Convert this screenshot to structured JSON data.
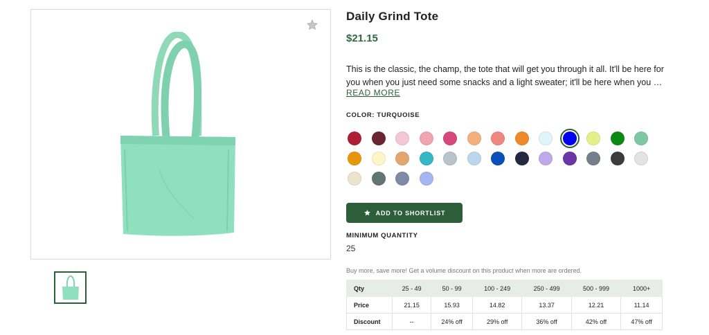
{
  "product": {
    "title": "Daily Grind Tote",
    "price": "$21.15",
    "description_line1": "This is the classic, the champ, the tote that will get you through it all. It'll be here for",
    "description_line2": "you when you just need some snacks and a light sweater; it'll be here when you hav…",
    "read_more_label": "READ MORE"
  },
  "colors": {
    "label": "COLOR: TURQUOISE",
    "selected_index": 9,
    "swatches": [
      "#b01e35",
      "#6b2530",
      "#f3c7d5",
      "#f0a5b3",
      "#d6497a",
      "#f3b07e",
      "#f0877f",
      "#ee8a2a",
      "#dff4fb",
      "#0000ee",
      "#e4f08a",
      "#0a8a12",
      "#7ec9a1",
      "#e9950c",
      "#fff5c9",
      "#e2a76f",
      "#35b7c5",
      "#b8c3ca",
      "#bcd6ee",
      "#0b50b8",
      "#25293f",
      "#c0a9ea",
      "#6c36a8",
      "#748089",
      "#3c3c3c",
      "#e3e3e3",
      "#ebe3cd",
      "#617674",
      "#7e8ba7",
      "#a6b4ef"
    ]
  },
  "actions": {
    "shortlist_label": "ADD TO SHORTLIST"
  },
  "minimum_quantity": {
    "label": "MINIMUM QUANTITY",
    "value": "25"
  },
  "pricing": {
    "note": "Buy more, save more! Get a volume discount on this product when more are ordered.",
    "header_label": "Qty",
    "ranges": [
      "25 - 49",
      "50 - 99",
      "100 - 249",
      "250 - 499",
      "500 - 999",
      "1000+"
    ],
    "price_label": "Price",
    "prices": [
      "21.15",
      "15.93",
      "14.82",
      "13.37",
      "12.21",
      "11.14"
    ],
    "discount_label": "Discount",
    "discounts": [
      "--",
      "24% off",
      "29% off",
      "36% off",
      "42% off",
      "47% off"
    ]
  },
  "media": {
    "main_image": "mint-tote-bag",
    "favorite_icon": "star-icon",
    "thumbnail_count": 1
  }
}
